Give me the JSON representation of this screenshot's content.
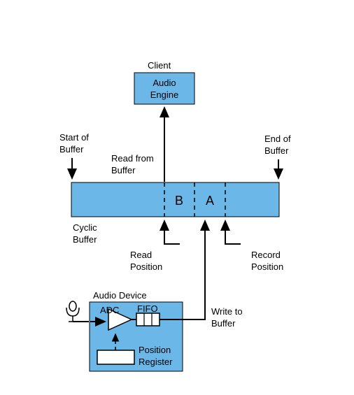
{
  "client_label": "Client",
  "audio_engine_l1": "Audio",
  "audio_engine_l2": "Engine",
  "start_of_l1": "Start of",
  "start_of_l2": "Buffer",
  "end_of_l1": "End of",
  "end_of_l2": "Buffer",
  "read_from_l1": "Read from",
  "read_from_l2": "Buffer",
  "region_b": "B",
  "region_a": "A",
  "cyclic_l1": "Cyclic",
  "cyclic_l2": "Buffer",
  "read_pos_l1": "Read",
  "read_pos_l2": "Position",
  "record_pos_l1": "Record",
  "record_pos_l2": "Position",
  "audio_device": "Audio Device",
  "adc": "ADC",
  "fifo": "FIFO",
  "pos_reg_l1": "Position",
  "pos_reg_l2": "Register",
  "write_to_l1": "Write to",
  "write_to_l2": "Buffer"
}
